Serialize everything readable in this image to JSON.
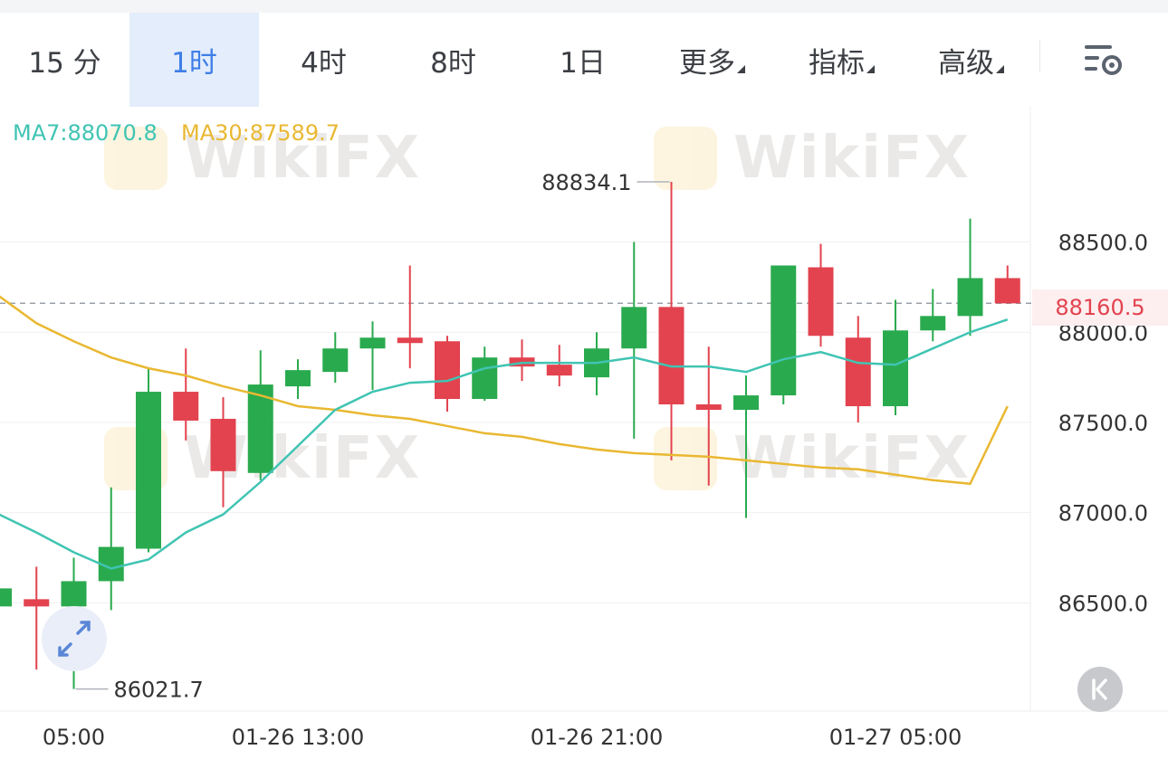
{
  "tabs": [
    {
      "label": "15 分",
      "active": false,
      "dropdown": false
    },
    {
      "label": "1时",
      "active": true,
      "dropdown": false
    },
    {
      "label": "4时",
      "active": false,
      "dropdown": false
    },
    {
      "label": "8时",
      "active": false,
      "dropdown": false
    },
    {
      "label": "1日",
      "active": false,
      "dropdown": false
    },
    {
      "label": "更多",
      "active": false,
      "dropdown": true
    },
    {
      "label": "指标",
      "active": false,
      "dropdown": true
    },
    {
      "label": "高级",
      "active": false,
      "dropdown": true
    }
  ],
  "icons": {
    "settings": "chart-settings-icon",
    "expand": "expand-arrows-icon",
    "collapse": "collapse-arrow-icon"
  },
  "colors": {
    "up": "#2aaa4e",
    "down": "#e2434f",
    "ma7": "#40c4b3",
    "ma30": "#e9b832",
    "accent": "#3f7ee8"
  },
  "watermark_text": "WikiFX",
  "chart_data": {
    "type": "candlestick",
    "indicators": [
      {
        "label": "MA7:88070.8",
        "color": "#40c4b3"
      },
      {
        "label": "MA30:87589.7",
        "color": "#e9b832"
      }
    ],
    "current_price": "88160.5",
    "high_label": "88834.1",
    "low_label": "86021.7",
    "ylim": [
      85900,
      89250
    ],
    "y_ticks": [
      "88500.0",
      "88000.0",
      "87500.0",
      "87000.0",
      "86500.0"
    ],
    "x_ticks": [
      {
        "label": "05:00",
        "index": 2
      },
      {
        "label": "01-26 13:00",
        "index": 8
      },
      {
        "label": "01-26 21:00",
        "index": 16
      },
      {
        "label": "01-27 05:00",
        "index": 24
      }
    ],
    "candles": [
      {
        "o": 86480,
        "h": 86980,
        "l": 86260,
        "c": 86580
      },
      {
        "o": 86520,
        "h": 86700,
        "l": 86130,
        "c": 86480
      },
      {
        "o": 86480,
        "h": 86750,
        "l": 86022,
        "c": 86620
      },
      {
        "o": 86620,
        "h": 87140,
        "l": 86460,
        "c": 86810
      },
      {
        "o": 86800,
        "h": 87800,
        "l": 86780,
        "c": 87670
      },
      {
        "o": 87670,
        "h": 87910,
        "l": 87400,
        "c": 87510
      },
      {
        "o": 87520,
        "h": 87640,
        "l": 87030,
        "c": 87230
      },
      {
        "o": 87220,
        "h": 87900,
        "l": 87180,
        "c": 87710
      },
      {
        "o": 87700,
        "h": 87850,
        "l": 87630,
        "c": 87790
      },
      {
        "o": 87780,
        "h": 88000,
        "l": 87720,
        "c": 87910
      },
      {
        "o": 87910,
        "h": 88060,
        "l": 87680,
        "c": 87970
      },
      {
        "o": 87970,
        "h": 88370,
        "l": 87800,
        "c": 87940
      },
      {
        "o": 87950,
        "h": 87980,
        "l": 87560,
        "c": 87630
      },
      {
        "o": 87630,
        "h": 87920,
        "l": 87620,
        "c": 87860
      },
      {
        "o": 87860,
        "h": 87960,
        "l": 87730,
        "c": 87810
      },
      {
        "o": 87820,
        "h": 87930,
        "l": 87700,
        "c": 87760
      },
      {
        "o": 87750,
        "h": 88000,
        "l": 87650,
        "c": 87910
      },
      {
        "o": 87910,
        "h": 88500,
        "l": 87410,
        "c": 88140
      },
      {
        "o": 88140,
        "h": 88834,
        "l": 87290,
        "c": 87600
      },
      {
        "o": 87600,
        "h": 87920,
        "l": 87150,
        "c": 87570
      },
      {
        "o": 87570,
        "h": 87760,
        "l": 86970,
        "c": 87650
      },
      {
        "o": 87650,
        "h": 88370,
        "l": 87600,
        "c": 88370
      },
      {
        "o": 88360,
        "h": 88490,
        "l": 87920,
        "c": 87980
      },
      {
        "o": 87970,
        "h": 88090,
        "l": 87500,
        "c": 87590
      },
      {
        "o": 87590,
        "h": 88180,
        "l": 87540,
        "c": 88010
      },
      {
        "o": 88010,
        "h": 88240,
        "l": 87950,
        "c": 88090
      },
      {
        "o": 88090,
        "h": 88630,
        "l": 87980,
        "c": 88300
      },
      {
        "o": 88300,
        "h": 88370,
        "l": 88160,
        "c": 88160
      }
    ],
    "ma7": [
      86990,
      86890,
      86780,
      86690,
      86740,
      86890,
      86990,
      87170,
      87370,
      87570,
      87670,
      87720,
      87730,
      87800,
      87830,
      87830,
      87830,
      87860,
      87810,
      87810,
      87780,
      87850,
      87890,
      87830,
      87820,
      87910,
      88000,
      88070.8
    ],
    "ma30": [
      88200,
      88050,
      87950,
      87860,
      87800,
      87760,
      87700,
      87650,
      87590,
      87570,
      87540,
      87520,
      87480,
      87440,
      87420,
      87380,
      87350,
      87330,
      87320,
      87310,
      87290,
      87270,
      87250,
      87240,
      87210,
      87180,
      87160,
      87589.7
    ]
  }
}
